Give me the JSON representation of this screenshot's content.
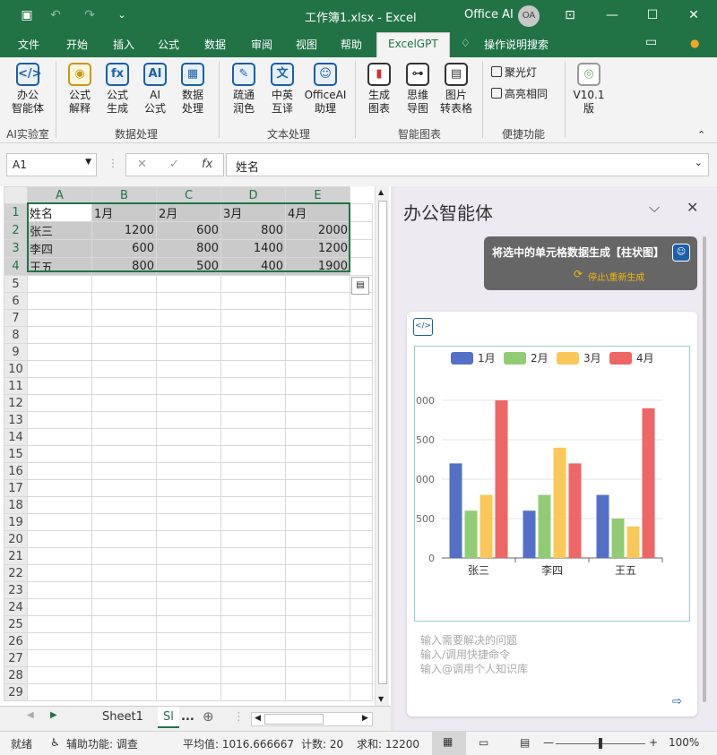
{
  "titlebar": {
    "file_title": "工作簿1.xlsx  -  Excel",
    "account": "Office AI",
    "avatar": "OA",
    "save_icon": "save-icon",
    "undo_icon": "undo-icon",
    "redo_icon": "redo-icon"
  },
  "tabs": [
    "文件",
    "开始",
    "插入",
    "公式",
    "数据",
    "审阅",
    "视图",
    "帮助",
    "ExcelGPT",
    "操作说明搜索"
  ],
  "ribbon": {
    "buttons": {
      "agent": "办公\n智能体",
      "formula_explain": "公式\n解释",
      "formula_gen": "公式\n生成",
      "ai_formula": "AI\n公式",
      "data_proc": "数据\n处理",
      "polish": "疏通\n润色",
      "translate": "中英\n互译",
      "assistant": "OfficeAI\n助理",
      "gen_chart": "生成\n图表",
      "mindmap": "思维\n导图",
      "img2table": "图片\n转表格",
      "version": "V10.1\n版"
    },
    "small": {
      "spotlight": "聚光灯",
      "highlight": "高亮相同"
    },
    "groups": {
      "lab": "AI实验室",
      "data": "数据处理",
      "text": "文本处理",
      "chart": "智能图表",
      "tools": "便捷功能"
    }
  },
  "formula_bar": {
    "name_box": "A1",
    "value": "姓名",
    "fx": "fx"
  },
  "sheet": {
    "columns": [
      "A",
      "B",
      "C",
      "D",
      "E"
    ],
    "header_row": [
      "姓名",
      "1月",
      "2月",
      "3月",
      "4月"
    ],
    "rows": [
      [
        "张三",
        "1200",
        "600",
        "800",
        "2000"
      ],
      [
        "李四",
        "600",
        "800",
        "1400",
        "1200"
      ],
      [
        "王五",
        "800",
        "500",
        "400",
        "1900"
      ]
    ],
    "row_numbers": [
      "1",
      "2",
      "3",
      "4",
      "5",
      "6",
      "7",
      "8",
      "9",
      "10",
      "11",
      "12",
      "13",
      "14",
      "15",
      "16",
      "17",
      "18",
      "19",
      "20",
      "21",
      "22",
      "23",
      "24",
      "25",
      "26",
      "27",
      "28",
      "29"
    ]
  },
  "sheet_tabs": {
    "sheet1": "Sheet1",
    "sheet2": "Sl",
    "more": "...",
    "add": "⊕"
  },
  "status": {
    "ready": "就绪",
    "accessibility": "辅助功能: 调查",
    "average": "平均值: 1016.666667",
    "count": "计数: 20",
    "sum": "求和: 12200",
    "zoom": "100%"
  },
  "pane": {
    "title": "办公智能体",
    "command": "将选中的单元格数据生成【柱状图】",
    "action": "停止\\重新生成",
    "placeholders": [
      "输入需要解决的问题",
      "输入/调用快捷命令",
      "输入@调用个人知识库"
    ]
  },
  "chart_data": {
    "type": "bar",
    "categories": [
      "张三",
      "李四",
      "王五"
    ],
    "series": [
      {
        "name": "1月",
        "values": [
          1200,
          600,
          800
        ],
        "color": "#5470c6"
      },
      {
        "name": "2月",
        "values": [
          600,
          800,
          500
        ],
        "color": "#91cc75"
      },
      {
        "name": "3月",
        "values": [
          800,
          1400,
          400
        ],
        "color": "#fac858"
      },
      {
        "name": "4月",
        "values": [
          2000,
          1200,
          1900
        ],
        "color": "#ee6666"
      }
    ],
    "yticks": [
      "0",
      "500",
      "000",
      "500",
      "000"
    ],
    "ylim": [
      0,
      2000
    ],
    "legend": "top"
  }
}
